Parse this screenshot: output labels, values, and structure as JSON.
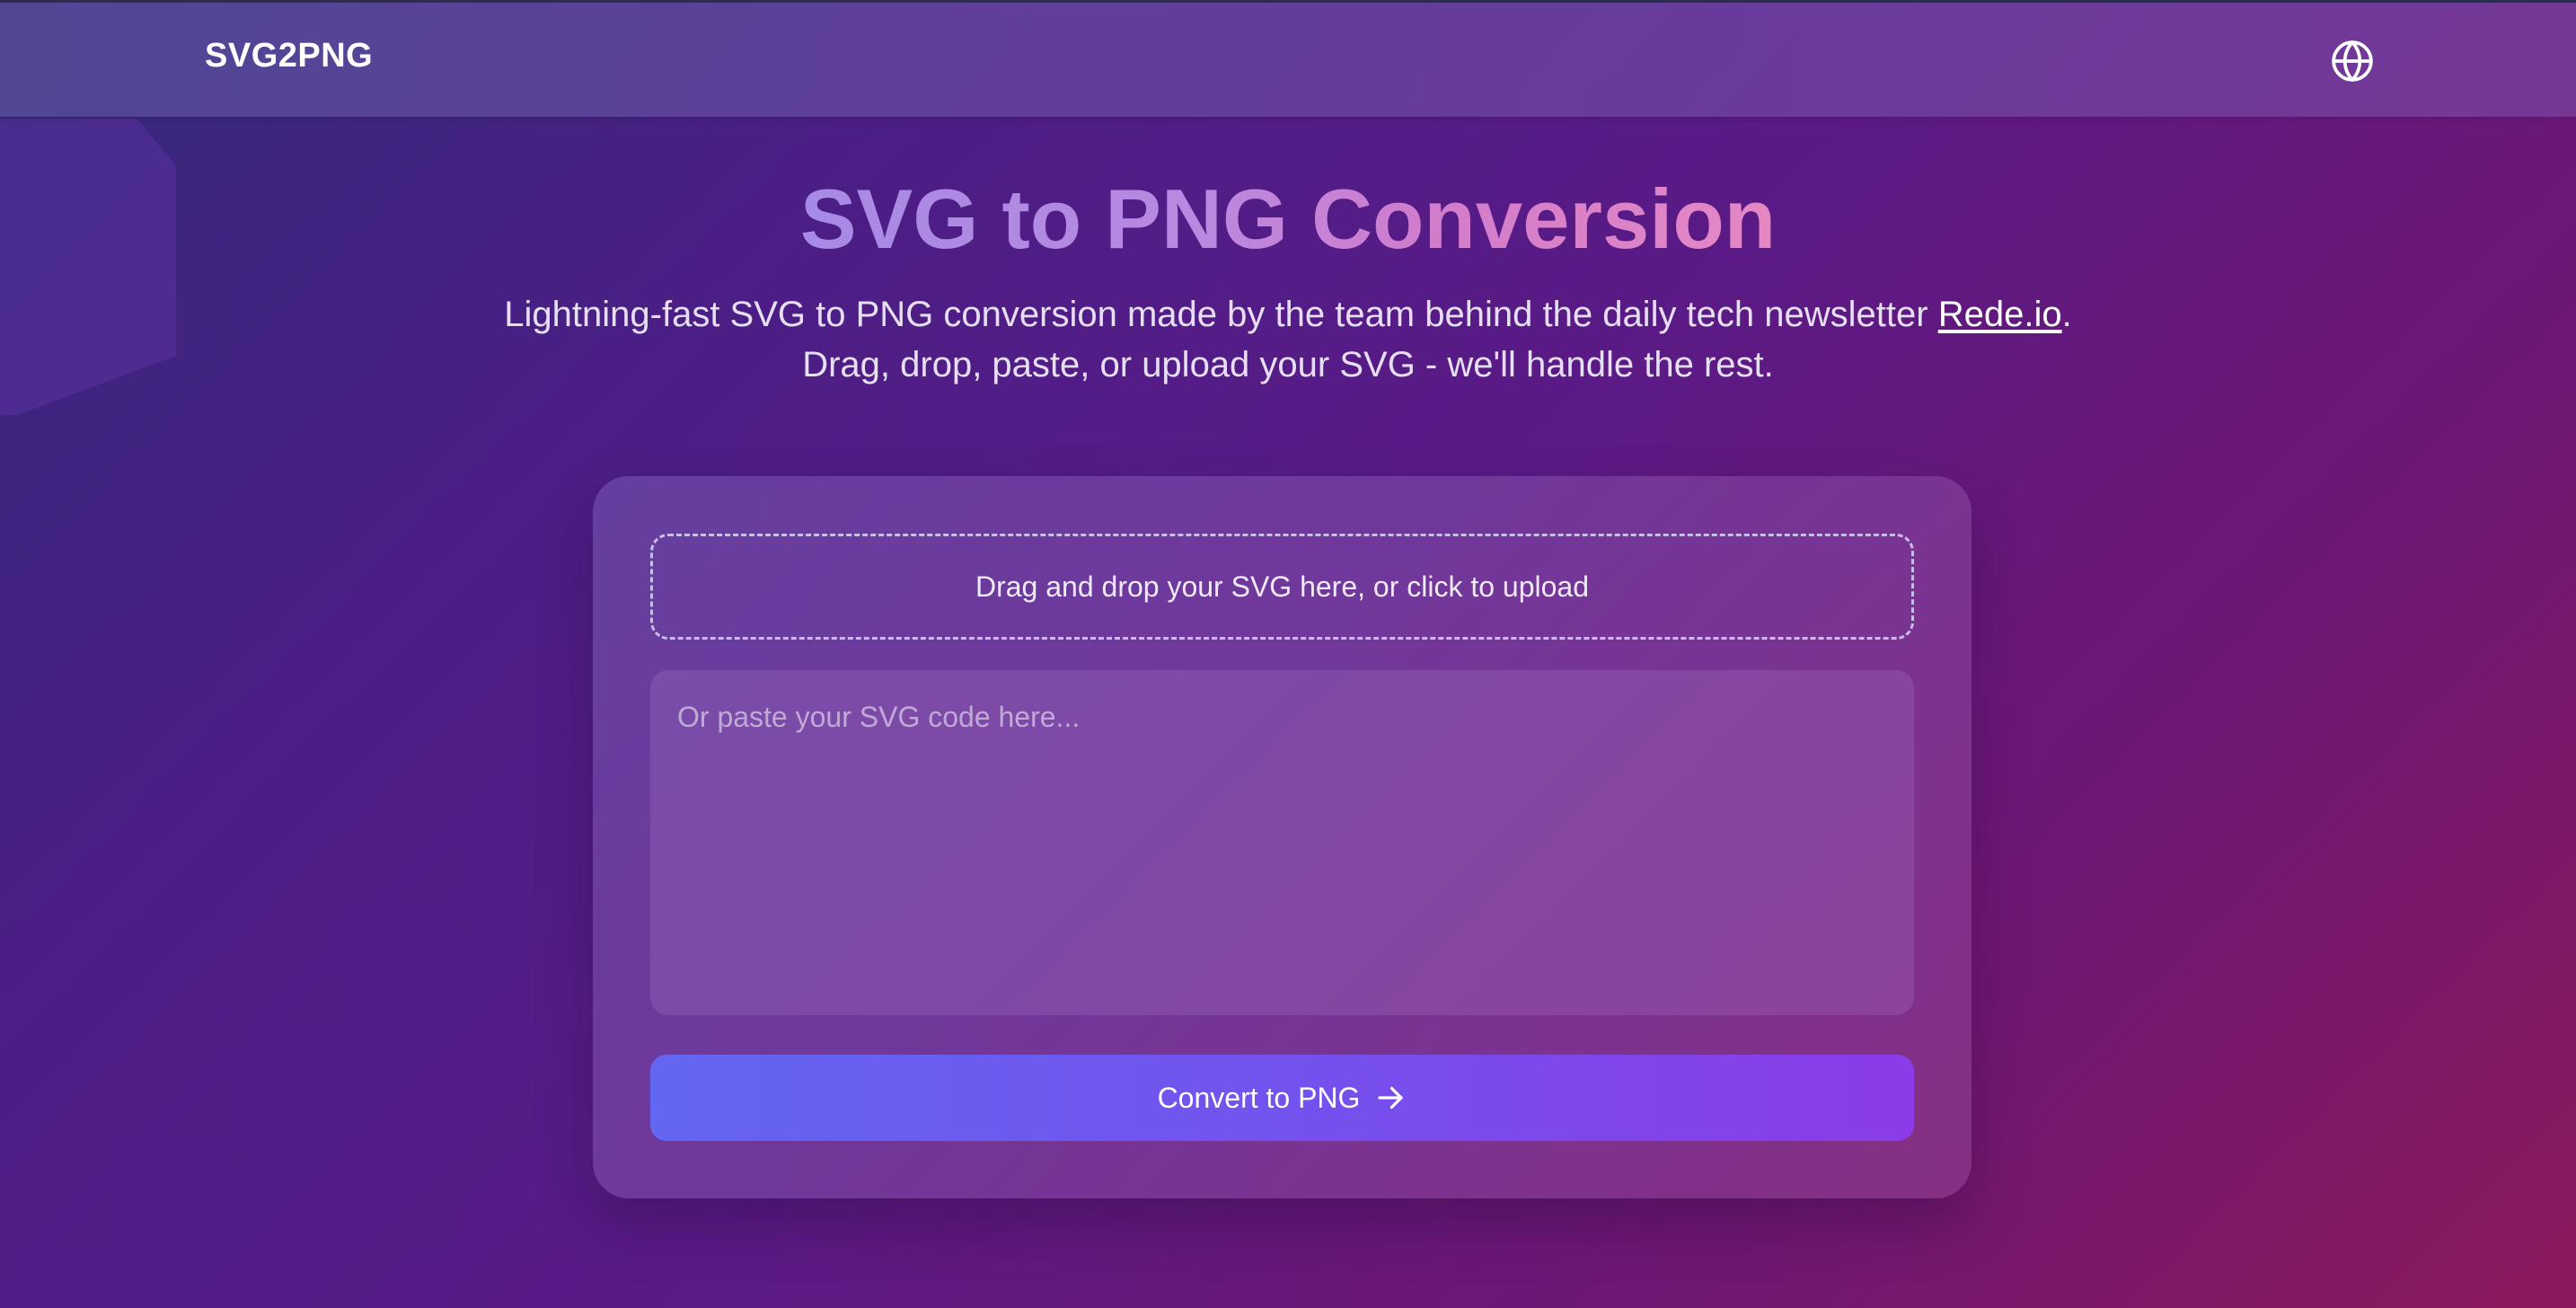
{
  "header": {
    "logo": "SVG2PNG",
    "language_icon": "globe-icon"
  },
  "hero": {
    "title": "SVG to PNG Conversion",
    "subtitle_line1_prefix": "Lightning-fast SVG to PNG conversion made by the team behind the daily tech newsletter ",
    "subtitle_link": "Rede.io",
    "subtitle_line1_suffix": ".",
    "subtitle_line2": "Drag, drop, paste, or upload your SVG - we'll handle the rest."
  },
  "converter": {
    "dropzone_text": "Drag and drop your SVG here, or click to upload",
    "code_placeholder": "Or paste your SVG code here...",
    "code_value": "",
    "convert_label": "Convert to PNG",
    "convert_icon": "arrow-right-icon"
  },
  "colors": {
    "accent_start": "#6366f1",
    "accent_end": "#8b3be8"
  }
}
